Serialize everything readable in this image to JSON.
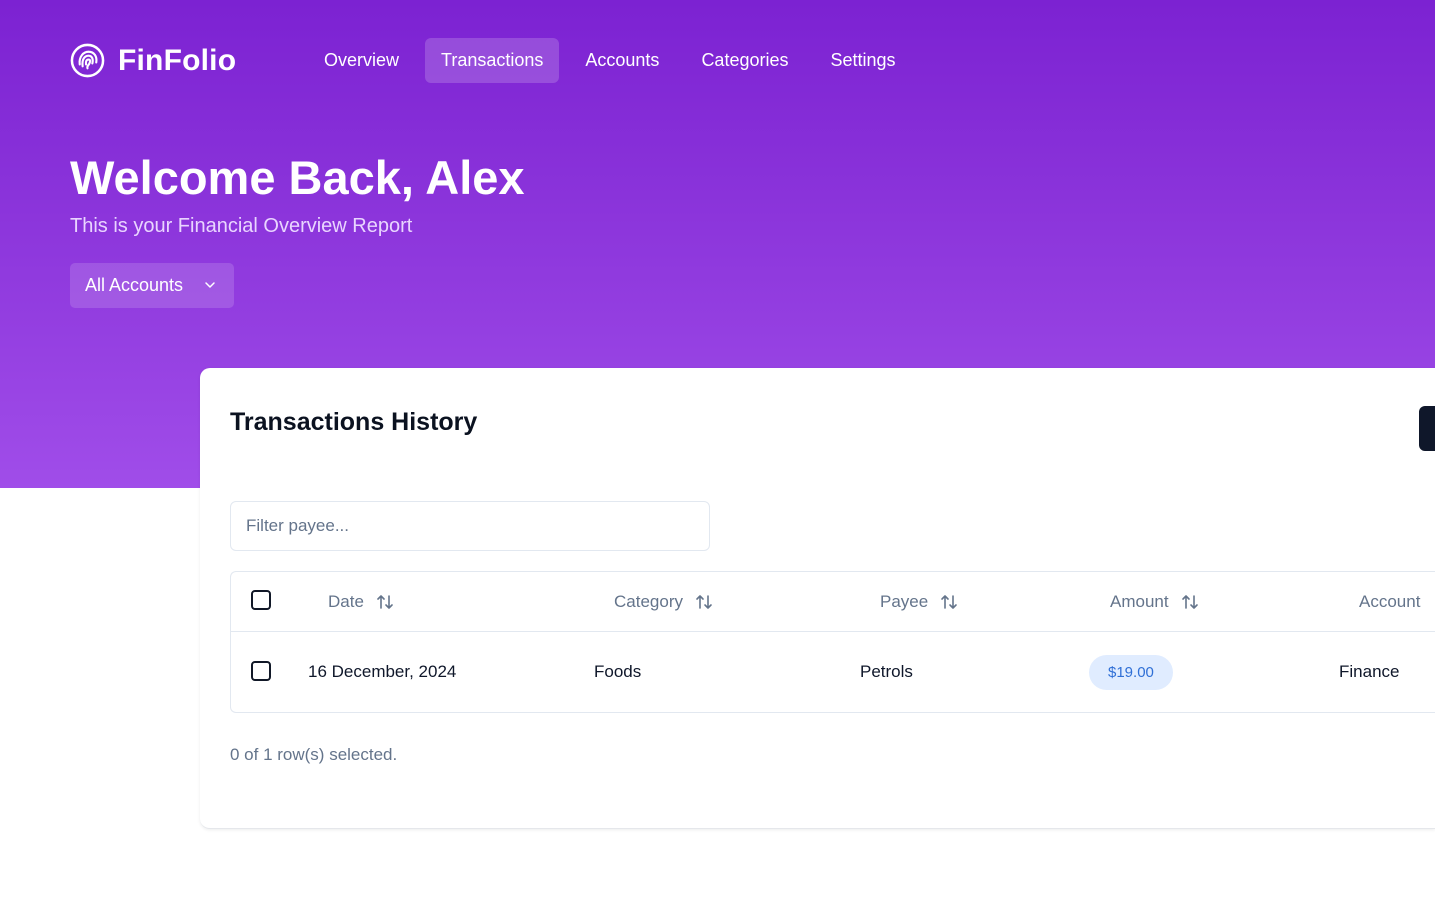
{
  "app": {
    "name": "FinFolio",
    "logo_icon": "fingerprint-icon"
  },
  "nav": {
    "items": [
      {
        "label": "Overview",
        "active": false
      },
      {
        "label": "Transactions",
        "active": true
      },
      {
        "label": "Accounts",
        "active": false
      },
      {
        "label": "Categories",
        "active": false
      },
      {
        "label": "Settings",
        "active": false
      }
    ]
  },
  "hero": {
    "title": "Welcome Back, Alex",
    "subtitle": "This is your Financial Overview Report",
    "account_filter": {
      "selected": "All Accounts",
      "icon": "chevron-down-icon"
    }
  },
  "transactions": {
    "title": "Transactions History",
    "filter_placeholder": "Filter payee...",
    "columns": [
      "Date",
      "Category",
      "Payee",
      "Amount",
      "Account"
    ],
    "rows": [
      {
        "date": "16 December, 2024",
        "category": "Foods",
        "payee": "Petrols",
        "amount": "$19.00",
        "account": "Finance"
      }
    ],
    "selection_status": "0 of 1 row(s) selected."
  },
  "colors": {
    "hero_gradient_start": "#7c22d2",
    "hero_gradient_end": "#a04de9",
    "amount_badge_bg": "#e0ecff",
    "amount_badge_text": "#2f6fd6",
    "primary_button": "#0f172a"
  }
}
